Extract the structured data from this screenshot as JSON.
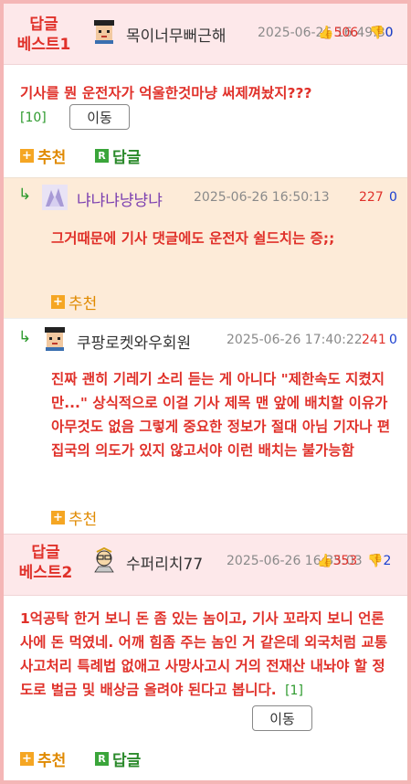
{
  "best1": {
    "label_line1": "답글",
    "label_line2": "베스트1",
    "nickname": "목이너무뻐근해",
    "date": "2025-06-26 16:49:30",
    "upvotes": "506",
    "downvotes": "0",
    "text": "기사를 뭔 운전자가 억울한것마냥 써제껴놨지???",
    "reply_count": "[10]",
    "move_label": "이동",
    "recommend_label": "추천",
    "reply_label": "답글"
  },
  "reply1": {
    "nickname": "냐냐냐냥냥냐",
    "date": "2025-06-26 16:50:13",
    "upvotes": "227",
    "downvotes": "0",
    "text": "그거때문에 기사 댓글에도 운전자 쉴드치는 증;;",
    "recommend_label": "추천"
  },
  "reply2": {
    "nickname": "쿠팡로켓와우회원",
    "date": "2025-06-26 17:40:22",
    "upvotes": "241",
    "downvotes": "0",
    "text": "진짜 괜히 기레기 소리 듣는 게 아니다 \"제한속도 지켰지만...\" 상식적으로 이걸 기사 제목 맨 앞에 배치할 이유가 아무것도 없음 그렇게 중요한 정보가 절대 아님 기자나 편집국의 의도가 있지 않고서야 이런 배치는 불가능함",
    "recommend_label": "추천"
  },
  "best2": {
    "label_line1": "답글",
    "label_line2": "베스트2",
    "nickname": "수퍼리치77",
    "date": "2025-06-26 16:35:03",
    "upvotes": "353",
    "downvotes": "2",
    "text": "1억공탁 한거 보니 돈 좀 있는 놈이고, 기사 꼬라지 보니 언론사에 돈 먹였네. 어깨 힘좀 주는 놈인 거 같은데 외국처럼 교통사고처리 특례법 없애고 사망사고시 거의 전재산 내놔야 할 정도로 벌금 및 배상금 올려야 된다고 봅니다.",
    "reply_count": "[1]",
    "move_label": "이동",
    "recommend_label": "추천",
    "reply_label": "답글"
  },
  "icons": {
    "recommend_box": "+",
    "reply_box": "R",
    "reply_arrow": "↳"
  },
  "colors": {
    "accent_red": "#e0312a",
    "down_blue": "#1a3fd0",
    "green": "#2e9a2e",
    "orange": "#e08a00",
    "best_bg": "#fde8ea",
    "reply_bg": "#fdebd8"
  }
}
